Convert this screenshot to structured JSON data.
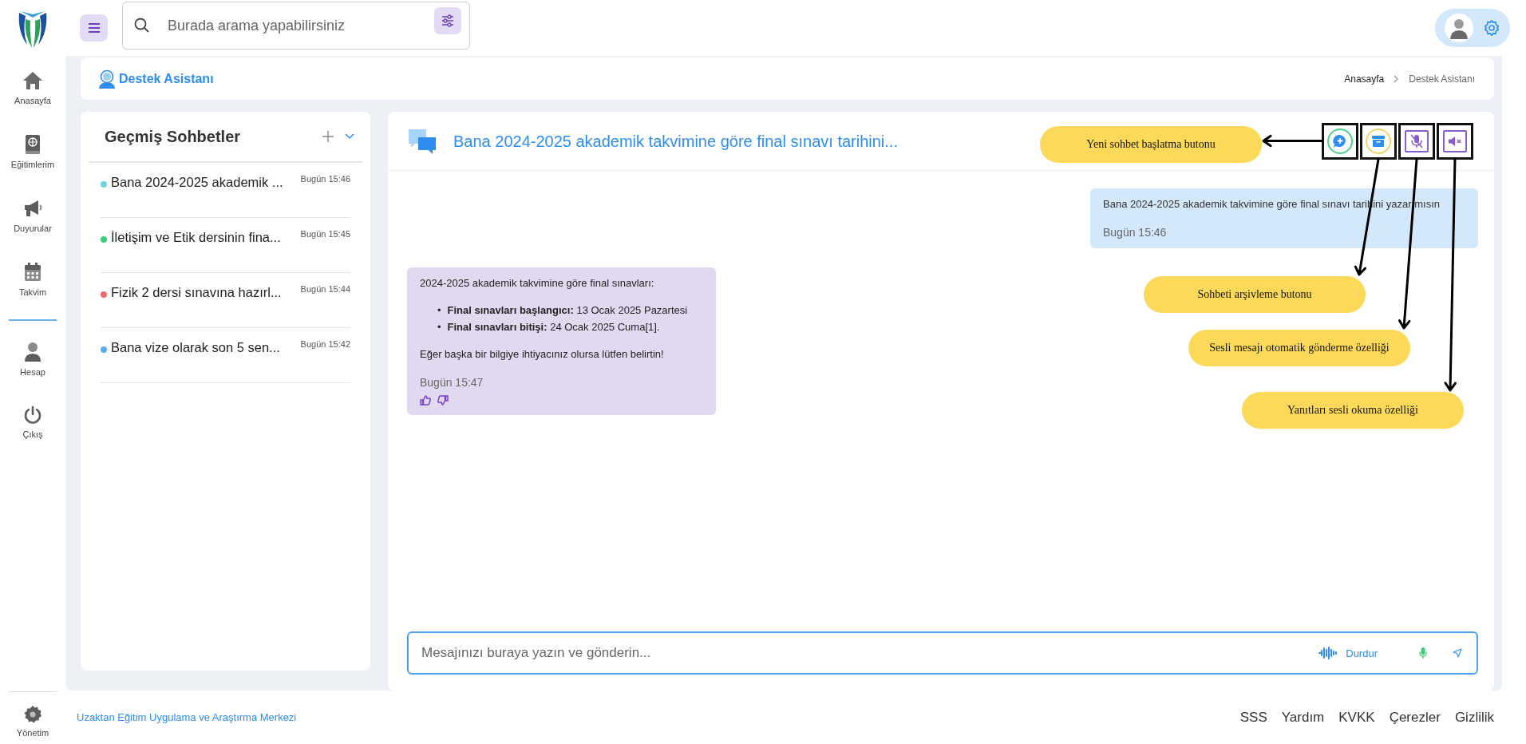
{
  "topbar": {
    "search": {
      "placeholder": "Burada arama yapabilirsiniz"
    }
  },
  "sidebar": {
    "items": [
      {
        "kind": "home",
        "label": "Anasayfa"
      },
      {
        "kind": "book",
        "label": "Eğitimlerim"
      },
      {
        "kind": "megaphone",
        "label": "Duyurular"
      },
      {
        "kind": "calendar",
        "label": "Takvim"
      },
      {
        "kind": "person",
        "label": "Hesap"
      },
      {
        "kind": "power",
        "label": "Çıkış"
      }
    ],
    "bottom_item": {
      "label": "Yönetim"
    }
  },
  "page_header": {
    "title": "Destek Asistanı",
    "breadcrumbs": [
      "Anasayfa",
      "Destek Asistanı"
    ]
  },
  "history": {
    "title": "Geçmiş Sohbetler",
    "chats": [
      {
        "title": "Bana 2024-2025 akademik ...",
        "time": "Bugün 15:46",
        "color": "#6dd5e0"
      },
      {
        "title": "İletişim ve Etik dersinin fina...",
        "time": "Bugün 15:45",
        "color": "#3ccf77"
      },
      {
        "title": "Fizik 2 dersi sınavına hazırl...",
        "time": "Bugün 15:44",
        "color": "#f06a6a"
      },
      {
        "title": "Bana vize olarak son 5 sen...",
        "time": "Bugün 15:42",
        "color": "#5aaaf5"
      }
    ]
  },
  "chat": {
    "title": "Bana 2024-2025 akademik takvimine göre final sınavı tarihini...",
    "messages": [
      {
        "kind": "user",
        "text": "Bana 2024-2025 akademik takvimine göre final sınavı tarihini yazar mısın",
        "time": "Bugün 15:46"
      },
      {
        "kind": "bot",
        "intro": "2024-2025 akademik takvimine göre final sınavları:",
        "bullets": [
          {
            "marker": "•",
            "text": "**Final sınavları başlangıcı:** 13 Ocak 2025 Pazartesi"
          },
          {
            "marker": "•",
            "text": "**Final sınavları bitişi:** 24 Ocak 2025 Cuma[1]."
          }
        ],
        "outro": "Eğer başka bir bilgiye ihtiyacınız olursa lütfen belirtin!",
        "time": "Bugün 15:47"
      }
    ],
    "input": {
      "placeholder": "Mesajınızı buraya yazın ve gönderin...",
      "stop_label": "Durdur"
    }
  },
  "annotations": [
    {
      "text": "Yeni sohbet başlatma butonu"
    },
    {
      "text": "Sohbeti arşivleme butonu"
    },
    {
      "text": "Sesli mesajı otomatik gönderme özelliği"
    },
    {
      "text": "Yanıtları sesli okuma özelliği"
    }
  ],
  "footer": {
    "text": "Uzaktan Eğitim Uygulama ve Araştırma Merkezi",
    "links": [
      "SSS",
      "Yardım",
      "KVKK",
      "Çerezler",
      "Gizlilik"
    ]
  }
}
